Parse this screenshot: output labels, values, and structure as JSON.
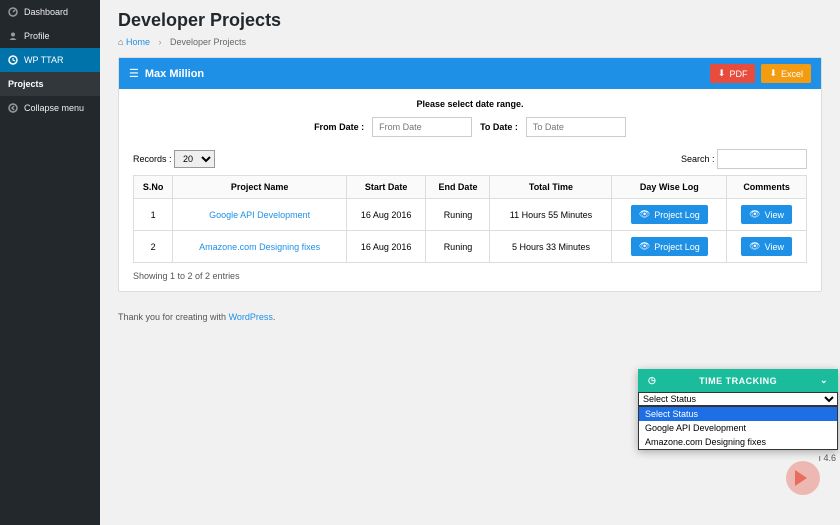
{
  "sidebar": {
    "items": [
      {
        "label": "Dashboard",
        "icon": "dashboard-icon"
      },
      {
        "label": "Profile",
        "icon": "user-icon"
      },
      {
        "label": "WP TTAR",
        "icon": "clock-icon"
      },
      {
        "label": "Collapse menu",
        "icon": "collapse-icon"
      }
    ],
    "sub": "Projects"
  },
  "page": {
    "title": "Developer Projects",
    "crumb_home": "Home",
    "crumb_current": "Developer Projects"
  },
  "panel": {
    "user": "Max Million",
    "pdf_label": "PDF",
    "excel_label": "Excel",
    "date_prompt": "Please select date range.",
    "from_label": "From Date :",
    "to_label": "To Date :",
    "from_ph": "From Date",
    "to_ph": "To Date",
    "records_label": "Records :",
    "records_value": "20",
    "search_label": "Search :"
  },
  "table": {
    "headers": [
      "S.No",
      "Project Name",
      "Start Date",
      "End Date",
      "Total Time",
      "Day Wise Log",
      "Comments"
    ],
    "rows": [
      {
        "sno": "1",
        "name": "Google API Development",
        "start": "16 Aug 2016",
        "end": "Runing",
        "time": "11 Hours  55 Minutes"
      },
      {
        "sno": "2",
        "name": "Amazone.com Designing fixes",
        "start": "16 Aug 2016",
        "end": "Runing",
        "time": "5 Hours  33 Minutes"
      }
    ],
    "btn_log": "Project Log",
    "btn_view": "View",
    "info": "Showing 1 to 2 of 2 entries"
  },
  "footer": {
    "text_a": "Thank you for creating with ",
    "link": "WordPress",
    "version": "4.6"
  },
  "tt": {
    "title": "TIME TRACKING",
    "sel": "Select Status",
    "opts": [
      "Select Status",
      "Google API Development",
      "Amazone.com Designing fixes"
    ]
  }
}
